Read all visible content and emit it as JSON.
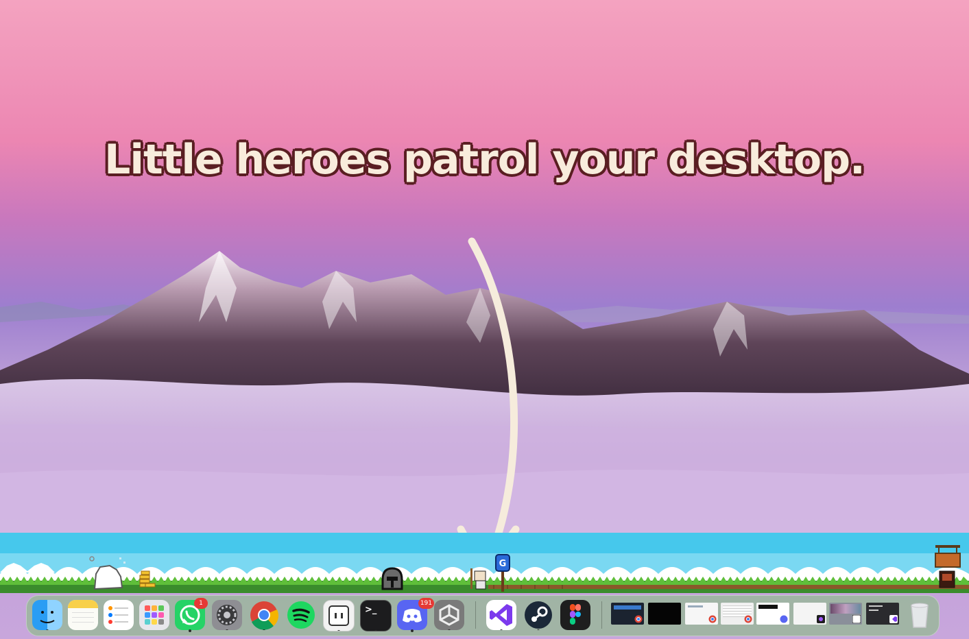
{
  "headline": "Little heroes patrol your desktop.",
  "colors": {
    "sky_top": "#f39fbf",
    "sky_mid": "#e87aa9",
    "sky_low": "#9b7ad0",
    "cloud": "#c9a9dc",
    "headline_fill": "#f8ecdc",
    "headline_outline": "#5a1e22",
    "arrow": "#f6ecdc",
    "game_sky": "#46c8ec",
    "game_grass": "#3a8c2c",
    "dock_bg": "#96b996"
  },
  "game": {
    "signpost_label": "G"
  },
  "dock": {
    "apps": [
      {
        "name": "Finder",
        "icon": "finder-icon",
        "running": true
      },
      {
        "name": "Notes",
        "icon": "notes-icon",
        "running": true
      },
      {
        "name": "Reminders",
        "icon": "reminders-icon",
        "running": false
      },
      {
        "name": "Launchpad",
        "icon": "launchpad-icon",
        "running": false
      },
      {
        "name": "WhatsApp",
        "icon": "whatsapp-icon",
        "running": true,
        "badge": "1"
      },
      {
        "name": "System Settings",
        "icon": "settings-gear-icon",
        "running": true
      },
      {
        "name": "Chrome",
        "icon": "chrome-icon",
        "running": true
      },
      {
        "name": "Spotify",
        "icon": "spotify-icon",
        "running": false
      },
      {
        "name": "Pixel Heroes",
        "icon": "heroes-app-icon",
        "running": true
      },
      {
        "name": "Terminal",
        "icon": "terminal-icon",
        "running": true,
        "glyph": ">_"
      },
      {
        "name": "Discord",
        "icon": "discord-icon",
        "running": true,
        "badge": "191"
      },
      {
        "name": "Unity",
        "icon": "unity-icon",
        "running": true
      },
      {
        "name": "Visual Studio",
        "icon": "visual-studio-icon",
        "running": true
      },
      {
        "name": "Steam",
        "icon": "steam-icon",
        "running": true
      },
      {
        "name": "Figma",
        "icon": "figma-icon",
        "running": false
      }
    ],
    "windows": [
      {
        "icon": "chrome-icon"
      },
      {
        "icon": ""
      },
      {
        "icon": "chrome-icon"
      },
      {
        "icon": "chrome-icon"
      },
      {
        "icon": "discord-icon"
      },
      {
        "icon": "figma-icon"
      },
      {
        "icon": "heroes-app-icon"
      },
      {
        "icon": "visual-studio-icon"
      }
    ],
    "trash": {
      "name": "Trash",
      "icon": "trash-icon"
    }
  }
}
